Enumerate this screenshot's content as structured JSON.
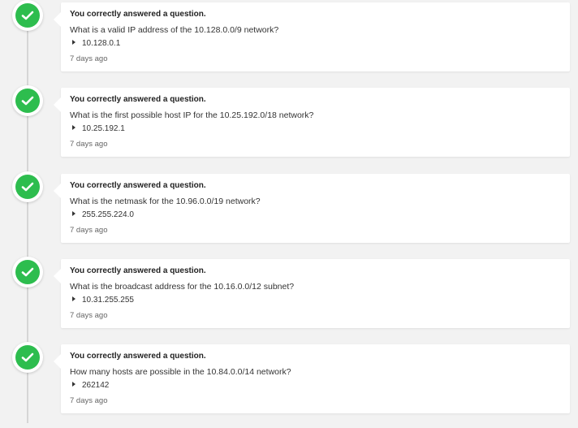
{
  "activity": {
    "items": [
      {
        "title": "You correctly answered a question.",
        "question": "What is a valid IP address of the 10.128.0.0/9 network?",
        "answer": "10.128.0.1",
        "time": "7 days ago"
      },
      {
        "title": "You correctly answered a question.",
        "question": "What is the first possible host IP for the 10.25.192.0/18 network?",
        "answer": "10.25.192.1",
        "time": "7 days ago"
      },
      {
        "title": "You correctly answered a question.",
        "question": "What is the netmask for the 10.96.0.0/19 network?",
        "answer": "255.255.224.0",
        "time": "7 days ago"
      },
      {
        "title": "You correctly answered a question.",
        "question": "What is the broadcast address for the 10.16.0.0/12 subnet?",
        "answer": "10.31.255.255",
        "time": "7 days ago"
      },
      {
        "title": "You correctly answered a question.",
        "question": "How many hosts are possible in the 10.84.0.0/14 network?",
        "answer": "262142",
        "time": "7 days ago"
      }
    ]
  },
  "colors": {
    "success": "#2dbd4e",
    "background": "#f2f2f2",
    "card": "#ffffff"
  },
  "icons": {
    "badge": "checkmark-icon",
    "answer_toggle": "caret-right-icon"
  }
}
